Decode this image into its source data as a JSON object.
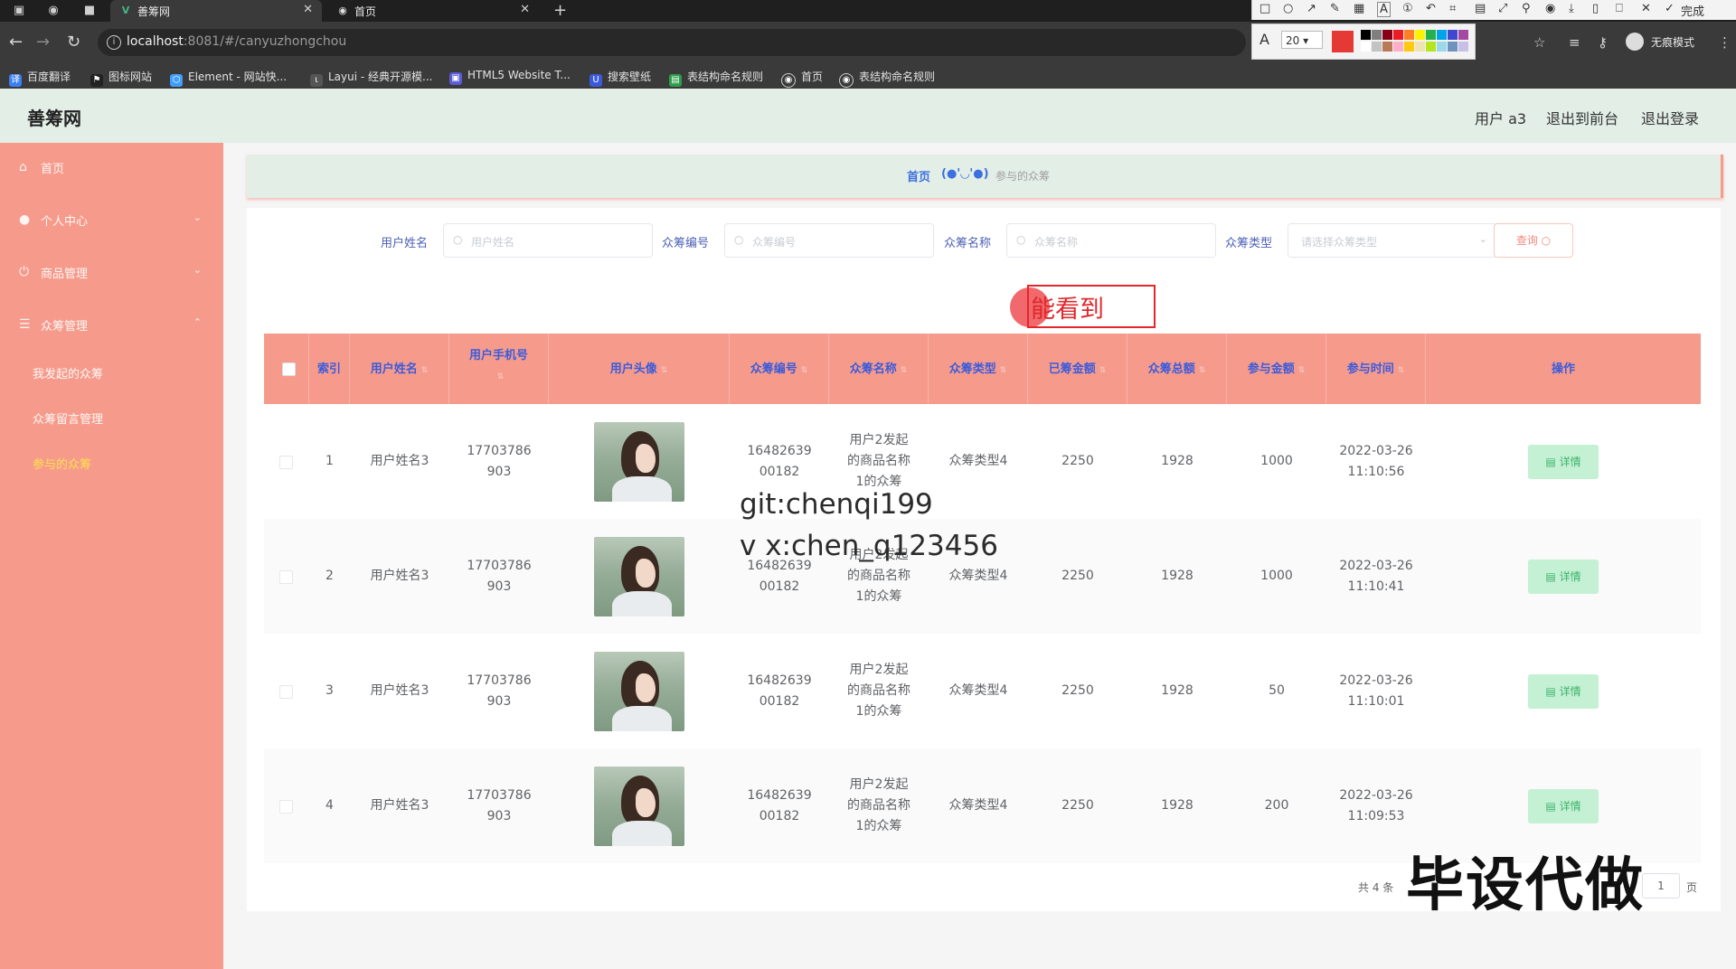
{
  "browser": {
    "tabs": [
      {
        "title": "善筹网",
        "active": true
      },
      {
        "title": "首页",
        "active": false
      }
    ],
    "url_host": "localhost",
    "url_path": ":8081/#/canyuzhongchou",
    "incognito_label": "无痕模式",
    "bookmarks": [
      "百度翻译",
      "图标网站",
      "Element - 网站快...",
      "Layui - 经典开源模...",
      "HTML5 Website T...",
      "搜索壁纸",
      "表结构命名规则",
      "首页",
      "表结构命名规则"
    ],
    "annotation_toolbar": {
      "done_label": "完成",
      "font_size": "20",
      "current_color": "#e53935"
    }
  },
  "header": {
    "brand": "善筹网",
    "user": "用户 a3",
    "back_to_front": "退出到前台",
    "logout": "退出登录"
  },
  "sidebar": {
    "items": [
      {
        "label": "首页",
        "icon": "home-icon"
      },
      {
        "label": "个人中心",
        "icon": "user-icon"
      },
      {
        "label": "商品管理",
        "icon": "power-icon"
      },
      {
        "label": "众筹管理",
        "icon": "menu-icon"
      }
    ],
    "sub_items": [
      "我发起的众筹",
      "众筹留言管理",
      "参与的众筹"
    ]
  },
  "breadcrumb": {
    "home": "首页",
    "face": "(●'◡'●)",
    "current": "参与的众筹"
  },
  "filters": {
    "username": {
      "label": "用户姓名",
      "placeholder": "用户姓名"
    },
    "code": {
      "label": "众筹编号",
      "placeholder": "众筹编号"
    },
    "name": {
      "label": "众筹名称",
      "placeholder": "众筹名称"
    },
    "type": {
      "label": "众筹类型",
      "placeholder": "请选择众筹类型"
    },
    "query_label": "查询"
  },
  "table": {
    "columns": [
      "索引",
      "用户姓名",
      "用户手机号",
      "用户头像",
      "众筹编号",
      "众筹名称",
      "众筹类型",
      "已筹金额",
      "众筹总额",
      "参与金额",
      "参与时间",
      "操作"
    ],
    "detail_label": "详情",
    "rows": [
      {
        "index": "1",
        "username": "用户姓名3",
        "phone": "17703786903",
        "code": "1648263900182",
        "name": "用户2发起的商品名称1的众筹",
        "type": "众筹类型4",
        "raised": "2250",
        "total": "1928",
        "amount": "1000",
        "date": "2022-03-26",
        "time": "11:10:56"
      },
      {
        "index": "2",
        "username": "用户姓名3",
        "phone": "17703786903",
        "code": "1648263900182",
        "name": "用户2发起的商品名称1的众筹",
        "type": "众筹类型4",
        "raised": "2250",
        "total": "1928",
        "amount": "1000",
        "date": "2022-03-26",
        "time": "11:10:41"
      },
      {
        "index": "3",
        "username": "用户姓名3",
        "phone": "17703786903",
        "code": "1648263900182",
        "name": "用户2发起的商品名称1的众筹",
        "type": "众筹类型4",
        "raised": "2250",
        "total": "1928",
        "amount": "50",
        "date": "2022-03-26",
        "time": "11:10:01"
      },
      {
        "index": "4",
        "username": "用户姓名3",
        "phone": "17703786903",
        "code": "1648263900182",
        "name": "用户2发起的商品名称1的众筹",
        "type": "众筹类型4",
        "raised": "2250",
        "total": "1928",
        "amount": "200",
        "date": "2022-03-26",
        "time": "11:09:53"
      }
    ]
  },
  "pagination": {
    "total": "共 4 条",
    "page": "1",
    "page_suffix": "页"
  },
  "overlays": {
    "annotation_text": "能看到",
    "watermark_git": "git:chenqi199",
    "watermark_wx": "v x:chen_q123456",
    "watermark_big": "毕设代做"
  },
  "colors": {
    "sidebar": "#f69b8c",
    "header": "#e2eee6",
    "table_header": "#f69b8c",
    "accent_blue": "#3b5bdb",
    "detail_button": "#c4f0d4"
  }
}
